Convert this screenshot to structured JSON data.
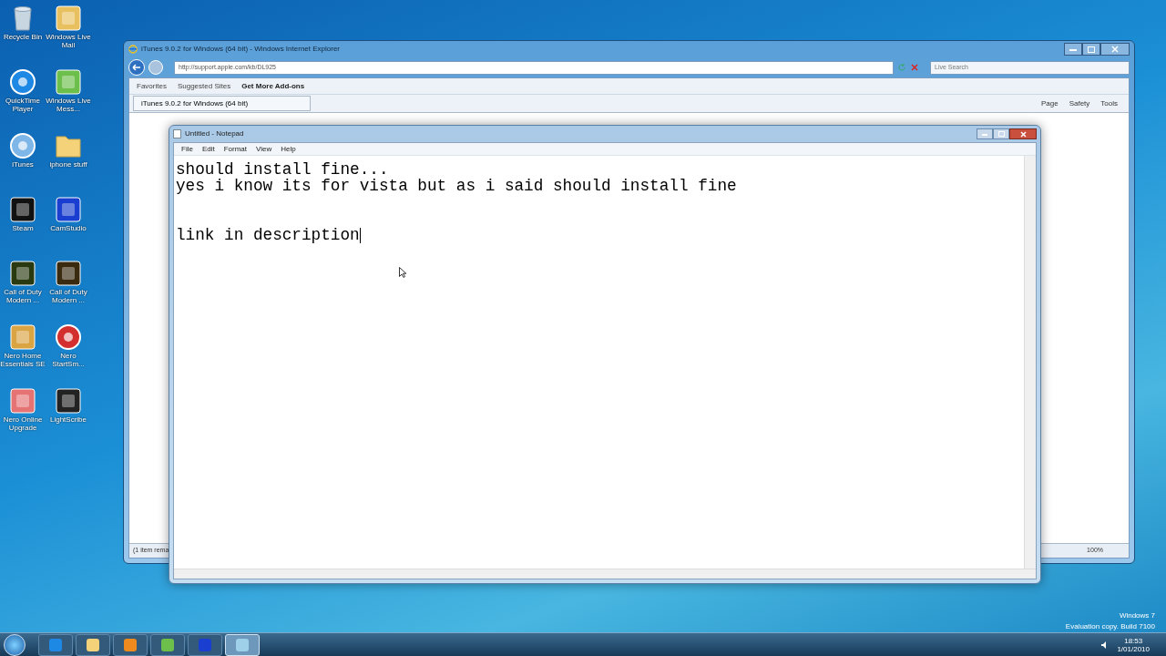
{
  "desktop_icons": [
    {
      "label": "Recycle Bin"
    },
    {
      "label": "Windows Live Mail"
    },
    {
      "label": "QuickTime Player"
    },
    {
      "label": "Windows Live Mess..."
    },
    {
      "label": "iTunes"
    },
    {
      "label": "iphone stuff"
    },
    {
      "label": "Steam"
    },
    {
      "label": "CamStudio"
    },
    {
      "label": "Call of Duty Modern ..."
    },
    {
      "label": "Call of Duty Modern ..."
    },
    {
      "label": "Nero Home Essentials SE"
    },
    {
      "label": "Nero StartSm..."
    },
    {
      "label": "Nero Online Upgrade"
    },
    {
      "label": "LightScribe"
    }
  ],
  "browser": {
    "title": "iTunes 9.0.2 for Windows (64 bit) - Windows Internet Explorer",
    "address": "http://support.apple.com/kb/DL925",
    "search": {
      "placeholder": "Live Search"
    },
    "favorites_bar": [
      "Favorites",
      "Suggested Sites",
      "Get More Add-ons"
    ],
    "tabs": [
      {
        "label": "iTunes 9.0.2 for Windows (64 bit)",
        "selected": true
      }
    ],
    "command_bar": [
      "Page",
      "Safety",
      "Tools"
    ],
    "status_bar": {
      "text": "(1 item rema",
      "zoom": "100%"
    }
  },
  "notepad": {
    "title": "Untitled - Notepad",
    "menu": [
      "File",
      "Edit",
      "Format",
      "View",
      "Help"
    ],
    "lines": [
      {
        "kind": "text",
        "text": "should install fine..."
      },
      {
        "kind": "text",
        "text": "yes i know its for vista but as i said should install fine"
      },
      {
        "kind": "blank"
      },
      {
        "kind": "blank"
      },
      {
        "kind": "text",
        "text": "link in description",
        "caret": true
      }
    ]
  },
  "watermark": {
    "line_1": "Windows 7",
    "line_2": "Evaluation copy. Build 7100"
  },
  "taskbar": {
    "buttons": [
      {
        "selected": false
      },
      {
        "selected": false
      },
      {
        "selected": false
      },
      {
        "selected": false
      },
      {
        "selected": false
      },
      {
        "selected": true
      }
    ],
    "time": "18:53",
    "date": "1/01/2010"
  }
}
